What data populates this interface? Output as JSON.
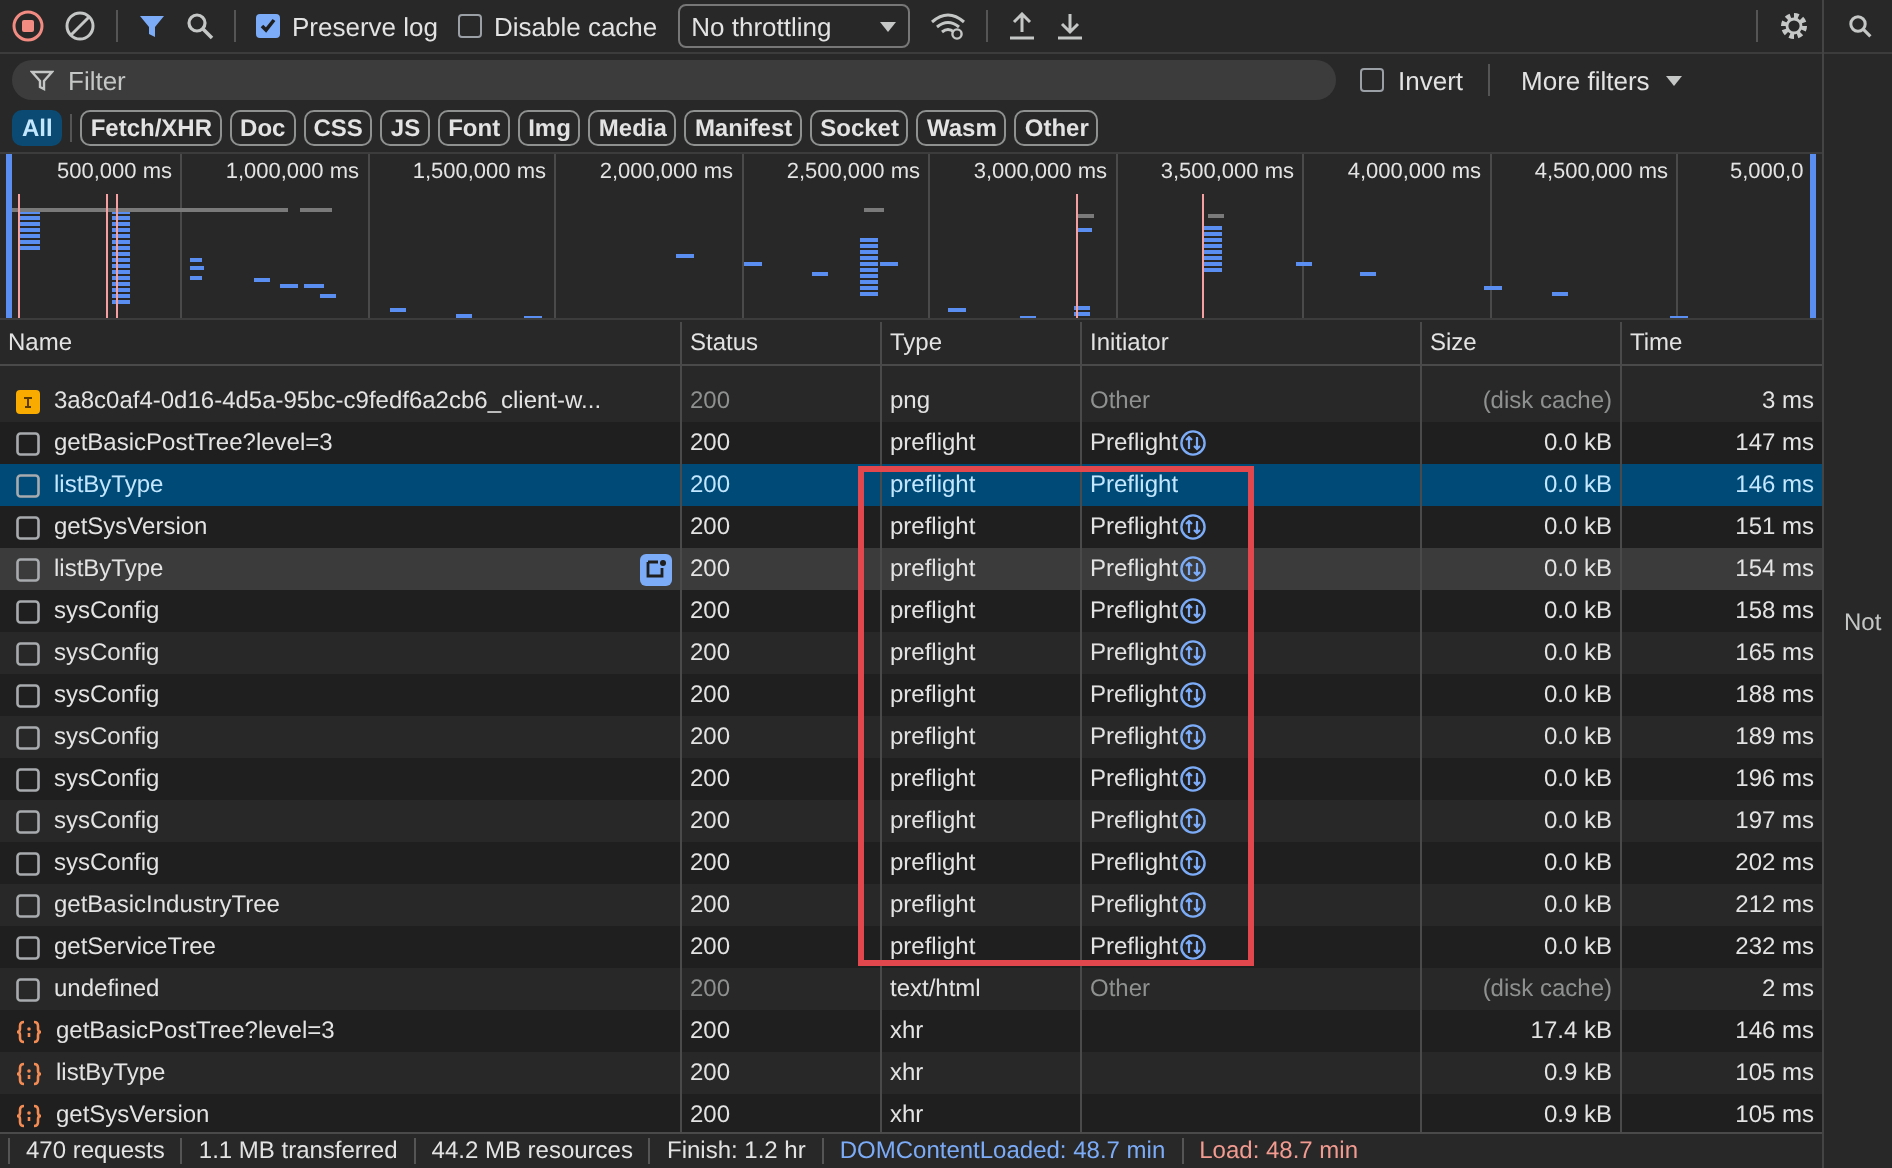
{
  "toolbar": {
    "preserve_log": {
      "label": "Preserve log",
      "checked": true
    },
    "disable_cache": {
      "label": "Disable cache",
      "checked": false
    },
    "throttling": "No throttling"
  },
  "filter": {
    "placeholder": "Filter",
    "invert": {
      "label": "Invert",
      "checked": false
    },
    "more_filters": "More filters"
  },
  "type_filters": [
    {
      "label": "All",
      "selected": true
    },
    {
      "label": "Fetch/XHR",
      "selected": false
    },
    {
      "label": "Doc",
      "selected": false
    },
    {
      "label": "CSS",
      "selected": false
    },
    {
      "label": "JS",
      "selected": false
    },
    {
      "label": "Font",
      "selected": false
    },
    {
      "label": "Img",
      "selected": false
    },
    {
      "label": "Media",
      "selected": false
    },
    {
      "label": "Manifest",
      "selected": false
    },
    {
      "label": "Socket",
      "selected": false
    },
    {
      "label": "Wasm",
      "selected": false
    },
    {
      "label": "Other",
      "selected": false
    }
  ],
  "overview": {
    "ticks": [
      "500,000 ms",
      "1,000,000 ms",
      "1,500,000 ms",
      "2,000,000 ms",
      "2,500,000 ms",
      "3,000,000 ms",
      "3,500,000 ms",
      "4,000,000 ms",
      "4,500,000 ms",
      "5,000,0"
    ]
  },
  "table": {
    "columns": [
      "Name",
      "Status",
      "Type",
      "Initiator",
      "Size",
      "Time"
    ],
    "rows": [
      {
        "kind": "image",
        "name": "3a8c0af4-0d16-4d5a-95bc-c9fedf6a2cb6_client-w...",
        "status": "200",
        "type": "png",
        "initiator": "Other",
        "size": "(disk cache)",
        "time": "3 ms",
        "cached": true,
        "selected": false,
        "hovered": false,
        "boxed": false
      },
      {
        "kind": "preflight",
        "name": "getBasicPostTree?level=3",
        "status": "200",
        "type": "preflight",
        "initiator": "Preflight",
        "size": "0.0 kB",
        "time": "147 ms",
        "cached": false,
        "selected": false,
        "hovered": false,
        "boxed": false
      },
      {
        "kind": "preflight",
        "name": "listByType",
        "status": "200",
        "type": "preflight",
        "initiator": "Preflight",
        "size": "0.0 kB",
        "time": "146 ms",
        "cached": false,
        "selected": true,
        "hovered": false,
        "boxed": true
      },
      {
        "kind": "preflight",
        "name": "getSysVersion",
        "status": "200",
        "type": "preflight",
        "initiator": "Preflight",
        "size": "0.0 kB",
        "time": "151 ms",
        "cached": false,
        "selected": false,
        "hovered": false,
        "boxed": true
      },
      {
        "kind": "preflight",
        "name": "listByType",
        "status": "200",
        "type": "preflight",
        "initiator": "Preflight",
        "size": "0.0 kB",
        "time": "154 ms",
        "cached": false,
        "selected": false,
        "hovered": true,
        "boxed": true
      },
      {
        "kind": "preflight",
        "name": "sysConfig",
        "status": "200",
        "type": "preflight",
        "initiator": "Preflight",
        "size": "0.0 kB",
        "time": "158 ms",
        "cached": false,
        "selected": false,
        "hovered": false,
        "boxed": true
      },
      {
        "kind": "preflight",
        "name": "sysConfig",
        "status": "200",
        "type": "preflight",
        "initiator": "Preflight",
        "size": "0.0 kB",
        "time": "165 ms",
        "cached": false,
        "selected": false,
        "hovered": false,
        "boxed": true
      },
      {
        "kind": "preflight",
        "name": "sysConfig",
        "status": "200",
        "type": "preflight",
        "initiator": "Preflight",
        "size": "0.0 kB",
        "time": "188 ms",
        "cached": false,
        "selected": false,
        "hovered": false,
        "boxed": true
      },
      {
        "kind": "preflight",
        "name": "sysConfig",
        "status": "200",
        "type": "preflight",
        "initiator": "Preflight",
        "size": "0.0 kB",
        "time": "189 ms",
        "cached": false,
        "selected": false,
        "hovered": false,
        "boxed": true
      },
      {
        "kind": "preflight",
        "name": "sysConfig",
        "status": "200",
        "type": "preflight",
        "initiator": "Preflight",
        "size": "0.0 kB",
        "time": "196 ms",
        "cached": false,
        "selected": false,
        "hovered": false,
        "boxed": true
      },
      {
        "kind": "preflight",
        "name": "sysConfig",
        "status": "200",
        "type": "preflight",
        "initiator": "Preflight",
        "size": "0.0 kB",
        "time": "197 ms",
        "cached": false,
        "selected": false,
        "hovered": false,
        "boxed": true
      },
      {
        "kind": "preflight",
        "name": "sysConfig",
        "status": "200",
        "type": "preflight",
        "initiator": "Preflight",
        "size": "0.0 kB",
        "time": "202 ms",
        "cached": false,
        "selected": false,
        "hovered": false,
        "boxed": true
      },
      {
        "kind": "preflight",
        "name": "getBasicIndustryTree",
        "status": "200",
        "type": "preflight",
        "initiator": "Preflight",
        "size": "0.0 kB",
        "time": "212 ms",
        "cached": false,
        "selected": false,
        "hovered": false,
        "boxed": true
      },
      {
        "kind": "preflight",
        "name": "getServiceTree",
        "status": "200",
        "type": "preflight",
        "initiator": "Preflight",
        "size": "0.0 kB",
        "time": "232 ms",
        "cached": false,
        "selected": false,
        "hovered": false,
        "boxed": true
      },
      {
        "kind": "document",
        "name": "undefined",
        "status": "200",
        "type": "text/html",
        "initiator": "Other",
        "size": "(disk cache)",
        "time": "2 ms",
        "cached": true,
        "selected": false,
        "hovered": false,
        "boxed": false
      },
      {
        "kind": "xhr",
        "name": "getBasicPostTree?level=3",
        "status": "200",
        "type": "xhr",
        "size": "17.4 kB",
        "time": "146 ms",
        "cached": false,
        "selected": false,
        "hovered": false,
        "boxed": false
      },
      {
        "kind": "xhr",
        "name": "listByType",
        "status": "200",
        "type": "xhr",
        "size": "0.9 kB",
        "time": "105 ms",
        "cached": false,
        "selected": false,
        "hovered": false,
        "boxed": false
      },
      {
        "kind": "xhr",
        "name": "getSysVersion",
        "status": "200",
        "type": "xhr",
        "size": "0.9 kB",
        "time": "105 ms",
        "cached": false,
        "selected": false,
        "hovered": false,
        "boxed": false
      }
    ]
  },
  "status_bar": [
    {
      "text": "470 requests",
      "kind": "plain"
    },
    {
      "text": "1.1 MB transferred",
      "kind": "plain"
    },
    {
      "text": "44.2 MB resources",
      "kind": "plain"
    },
    {
      "text": "Finish: 1.2 hr",
      "kind": "plain"
    },
    {
      "text": "DOMContentLoaded: 48.7 min",
      "kind": "dom"
    },
    {
      "text": "Load: 48.7 min",
      "kind": "load"
    }
  ],
  "side_panel": {
    "text": "Not"
  }
}
